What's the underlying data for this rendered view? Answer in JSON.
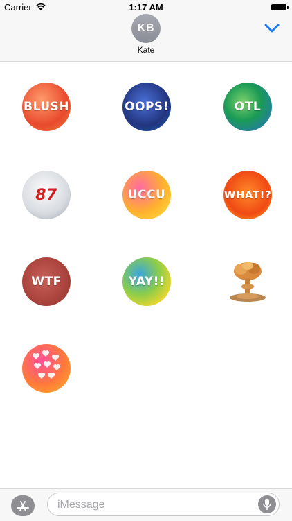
{
  "status_bar": {
    "carrier": "Carrier",
    "time": "1:17 AM",
    "icons": [
      "wifi-icon",
      "battery-icon"
    ]
  },
  "header": {
    "avatar_initials": "KB",
    "contact_name": "Kate",
    "collapse_icon": "chevron-down-icon",
    "accent_color": "#1a7cf5"
  },
  "stickers": [
    {
      "label": "BLUSH"
    },
    {
      "label": "OOPS!"
    },
    {
      "label": "OTL"
    },
    {
      "label": "87"
    },
    {
      "label": "UCCU"
    },
    {
      "label": "WHAT!?"
    },
    {
      "label": "WTF"
    },
    {
      "label": "YAY!!"
    },
    {
      "label": "",
      "icon": "mushroom-cloud-icon"
    },
    {
      "label": "",
      "icon": "hearts-icon"
    }
  ],
  "input_bar": {
    "apps_icon": "app-store-icon",
    "placeholder": "iMessage",
    "mic_icon": "microphone-icon"
  }
}
